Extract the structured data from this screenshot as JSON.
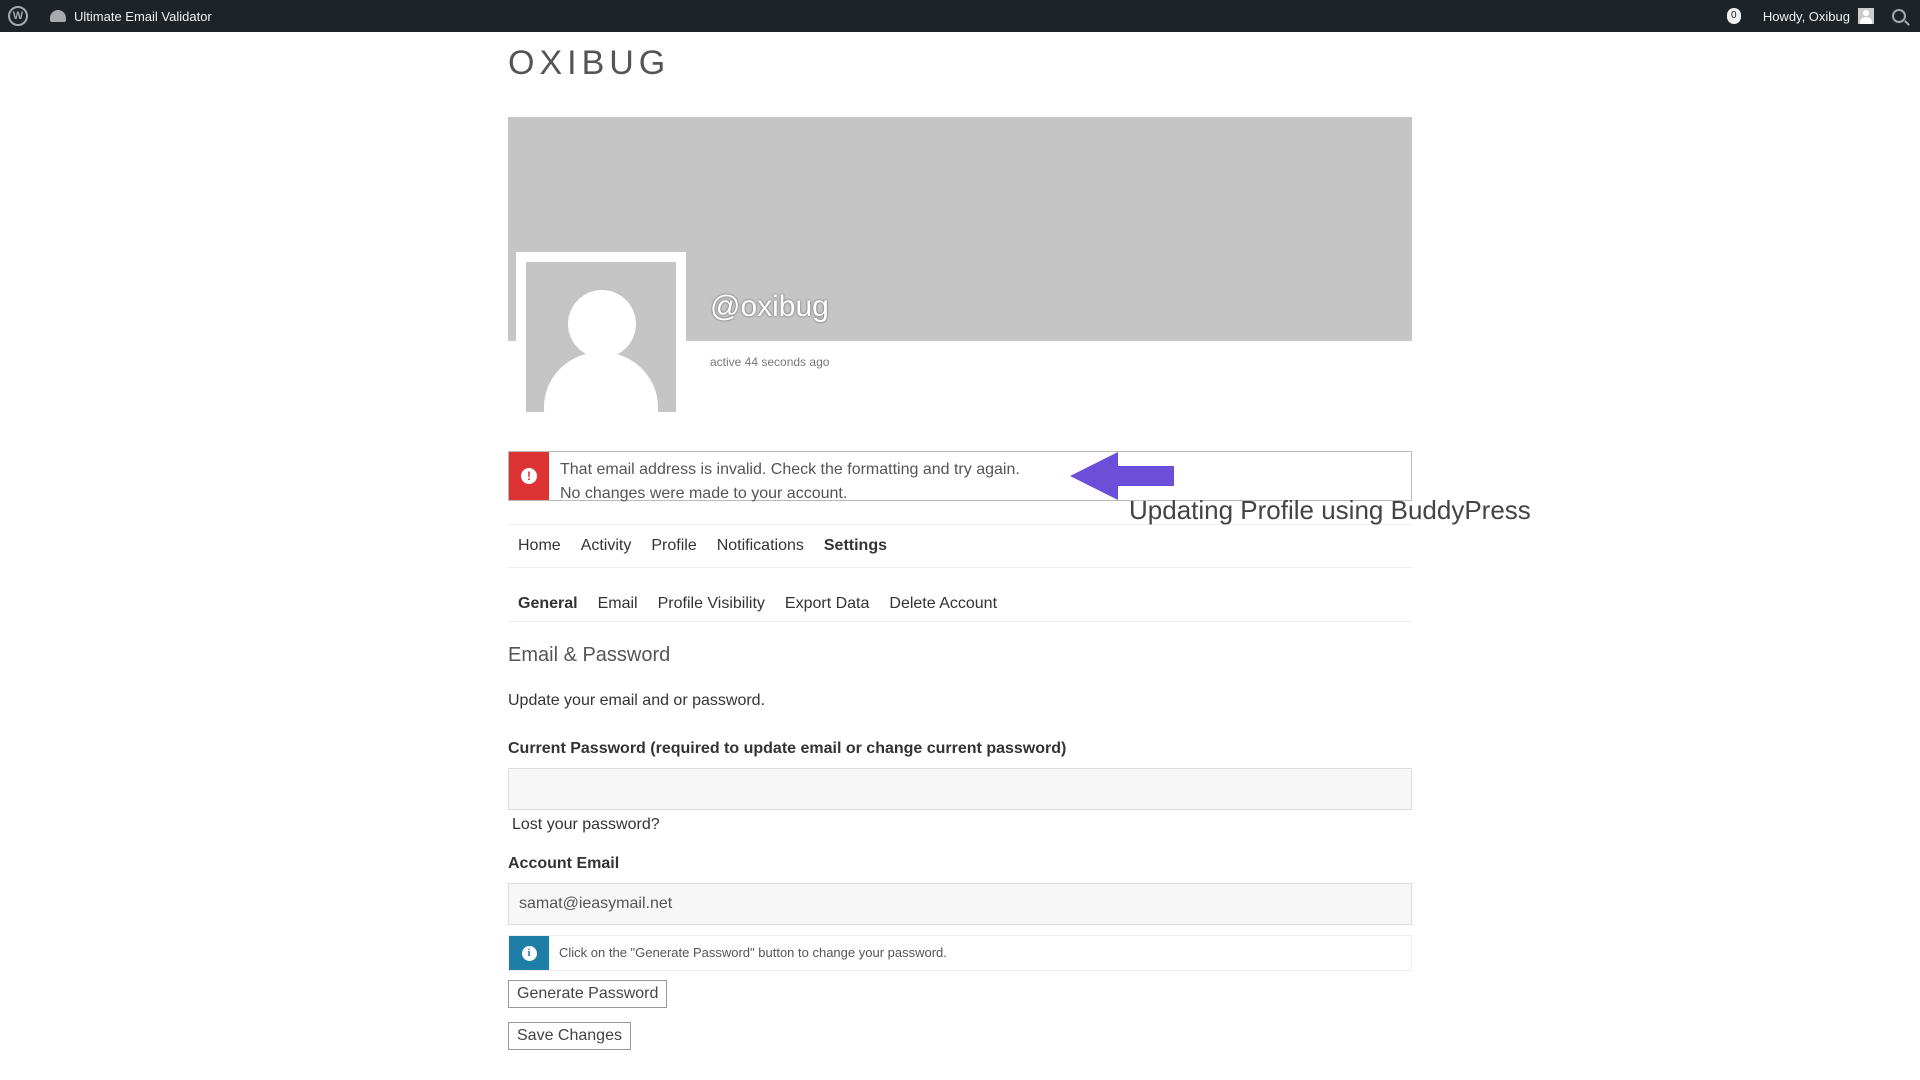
{
  "adminbar": {
    "site_name": "Ultimate Email Validator",
    "notification_count": "0",
    "greeting": "Howdy, Oxibug"
  },
  "site": {
    "title": "OXIBUG"
  },
  "profile": {
    "handle": "@oxibug",
    "activity": "active 44 seconds ago"
  },
  "alert": {
    "line1": "That email address is invalid. Check the formatting and try again.",
    "line2": "No changes were made to your account."
  },
  "annotation": {
    "text": "Updating Profile using BuddyPress",
    "arrow_color": "#6b4fd8"
  },
  "nav": {
    "items": [
      "Home",
      "Activity",
      "Profile",
      "Notifications",
      "Settings"
    ],
    "active": "Settings"
  },
  "subnav": {
    "items": [
      "General",
      "Email",
      "Profile Visibility",
      "Export Data",
      "Delete Account"
    ],
    "active": "General"
  },
  "form": {
    "section_title": "Email & Password",
    "intro": "Update your email and or password.",
    "current_password_label": "Current Password (required to update email or change current password)",
    "current_password_value": "",
    "lost_password": "Lost your password?",
    "email_label": "Account Email",
    "email_value": "samat@ieasymail.net",
    "info_text": "Click on the \"Generate Password\" button to change your password.",
    "generate_button": "Generate Password",
    "save_button": "Save Changes"
  },
  "colors": {
    "error": "#dd3333",
    "info": "#1f7ea6",
    "adminbar": "#1d2327",
    "cover": "#c5c5c5"
  }
}
